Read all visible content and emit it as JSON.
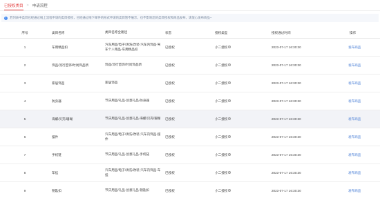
{
  "tabs": {
    "active": "已授权类目",
    "separator": ">",
    "inactive": "申请流程"
  },
  "notice": "若列表中类目已经通过线上流程申请的类目授权，已经通过线下邮件的形式申请的类目暂不展示，也不影响您的类目授权和商品发布，请放心发布商品~",
  "columns": {
    "no": "序号",
    "name": "类目名称",
    "path": "类目名称全路径",
    "status": "状态",
    "method": "授权类型",
    "time": "授权通过时间",
    "op": "操作"
  },
  "rows": [
    {
      "no": "1",
      "name": "车用精品扣",
      "path": "汽车用品/电子/清洗/改装-汽车内饰品-驾车个人用品-车用精品扣",
      "status": "已授权",
      "method": "小二授权",
      "time": "2023-07-17 16:30:30",
      "op": "发布商品"
    },
    {
      "no": "2",
      "name": "饰品/流行首饰/时尚饰品新",
      "path": "饰品/流行首饰/时尚饰品新",
      "status": "已授权",
      "method": "小二授权",
      "time": "2023-07-17 16:30:30",
      "op": "发布商品"
    },
    {
      "no": "3",
      "name": "家居饰品",
      "path": "家居饰品",
      "status": "已授权",
      "method": "小二授权",
      "time": "2023-07-17 16:30:30",
      "op": "发布商品"
    },
    {
      "no": "4",
      "name": "防身器",
      "path": "节庆用品/礼品-创意礼品-防身器",
      "status": "已授权",
      "method": "小二授权",
      "time": "2023-07-17 16:30:30",
      "op": "发布商品"
    },
    {
      "no": "5",
      "name": "海螺/贝壳/珊瑚",
      "path": "节庆用品/礼品-创意礼品-海螺/贝壳/珊瑚",
      "status": "已授权",
      "method": "小二授权",
      "time": "2023-07-17 16:30:30",
      "op": "发布商品"
    },
    {
      "no": "6",
      "name": "摆件",
      "path": "汽车用品/电子/清洗/改装-汽车内饰品-摆件",
      "status": "已授权",
      "method": "小二授权",
      "time": "2023-07-17 16:30:30",
      "op": "发布商品"
    },
    {
      "no": "7",
      "name": "手机链",
      "path": "节庆用品/礼品-创意礼品-手机链",
      "status": "已授权",
      "method": "小二授权",
      "time": "2023-07-17 16:30:30",
      "op": "发布商品"
    },
    {
      "no": "8",
      "name": "车挂",
      "path": "汽车用品/电子/清洗/改装-汽车内饰品-车挂",
      "status": "已授权",
      "method": "小二授权",
      "time": "2023-07-17 16:30:30",
      "op": "发布商品"
    },
    {
      "no": "9",
      "name": "钥匙扣",
      "path": "节庆用品/礼品-创意礼品-钥匙扣",
      "status": "已授权",
      "method": "小二授权",
      "time": "2023-07-17 16:30:30",
      "op": "发布商品"
    }
  ],
  "highlight_row": 5,
  "colors": {
    "accent": "#e23b3b",
    "link": "#4a7fd6",
    "notice_bg": "#f5f7fb",
    "info": "#4a8df0"
  },
  "icons": {
    "notice": "info-icon",
    "method_help": "help-icon"
  }
}
